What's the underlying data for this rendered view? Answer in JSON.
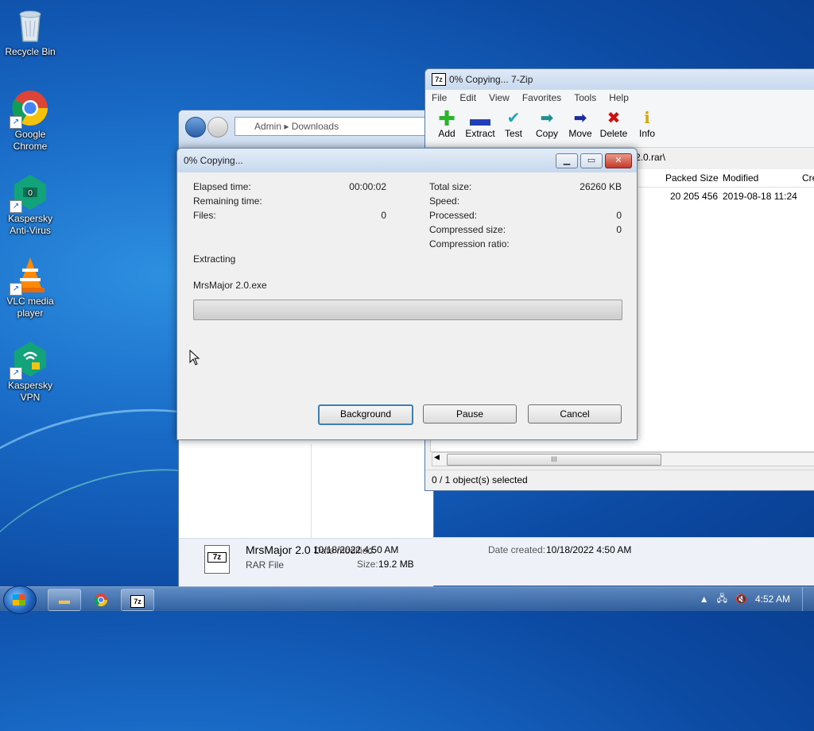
{
  "desktop": {
    "icons": [
      {
        "label": "Recycle Bin",
        "icon": "recycle-bin-icon"
      },
      {
        "label": "Google Chrome",
        "icon": "chrome-icon"
      },
      {
        "label": "Kaspersky Anti-Virus",
        "icon": "kaspersky-antivirus-icon"
      },
      {
        "label": "VLC media player",
        "icon": "vlc-icon"
      },
      {
        "label": "Kaspersky VPN",
        "icon": "kaspersky-vpn-icon"
      }
    ]
  },
  "explorer": {
    "breadcrumb": [
      "Admin",
      "Downloads"
    ],
    "details": {
      "name": "MrsMajor 2.0",
      "type": "RAR File",
      "date_modified_label": "Date modified:",
      "date_modified": "10/18/2022 4:50 AM",
      "date_created_label": "Date created:",
      "date_created": "10/18/2022 4:50 AM",
      "size_label": "Size:",
      "size": "19.2 MB"
    }
  },
  "zip": {
    "title": "0% Copying... 7-Zip",
    "menu": [
      "File",
      "Edit",
      "View",
      "Favorites",
      "Tools",
      "Help"
    ],
    "toolbar": [
      {
        "label": "Add",
        "icon": "plus-icon",
        "color": "#2bb32b"
      },
      {
        "label": "Extract",
        "icon": "minus-icon",
        "color": "#1e3fb8"
      },
      {
        "label": "Test",
        "icon": "check-icon",
        "color": "#25a5b5"
      },
      {
        "label": "Copy",
        "icon": "copy-arrow-icon",
        "color": "#1f8f8f"
      },
      {
        "label": "Move",
        "icon": "move-arrow-icon",
        "color": "#1a2aa0"
      },
      {
        "label": "Delete",
        "icon": "x-icon",
        "color": "#d01010"
      },
      {
        "label": "Info",
        "icon": "info-icon",
        "color": "#d4a800"
      }
    ],
    "path_fragment": "2.0.rar\\",
    "columns": [
      "Packed Size",
      "Modified",
      "Cre"
    ],
    "row": {
      "packed_size": "20 205 456",
      "modified": "2019-08-18 11:24"
    },
    "scroll_grip": "III",
    "status": "0 / 1 object(s) selected"
  },
  "dialog": {
    "title": "0% Copying...",
    "elapsed_label": "Elapsed time:",
    "elapsed_value": "00:00:02",
    "remaining_label": "Remaining time:",
    "files_label": "Files:",
    "files_value": "0",
    "total_size_label": "Total size:",
    "total_size_value": "26260 KB",
    "speed_label": "Speed:",
    "processed_label": "Processed:",
    "processed_value": "0",
    "compressed_label": "Compressed size:",
    "compressed_value": "0",
    "ratio_label": "Compression ratio:",
    "operation": "Extracting",
    "current_file": "MrsMajor 2.0.exe",
    "progress": 0,
    "buttons": {
      "background": "Background",
      "pause": "Pause",
      "cancel": "Cancel"
    }
  },
  "taskbar": {
    "clock": "4:52 AM"
  }
}
